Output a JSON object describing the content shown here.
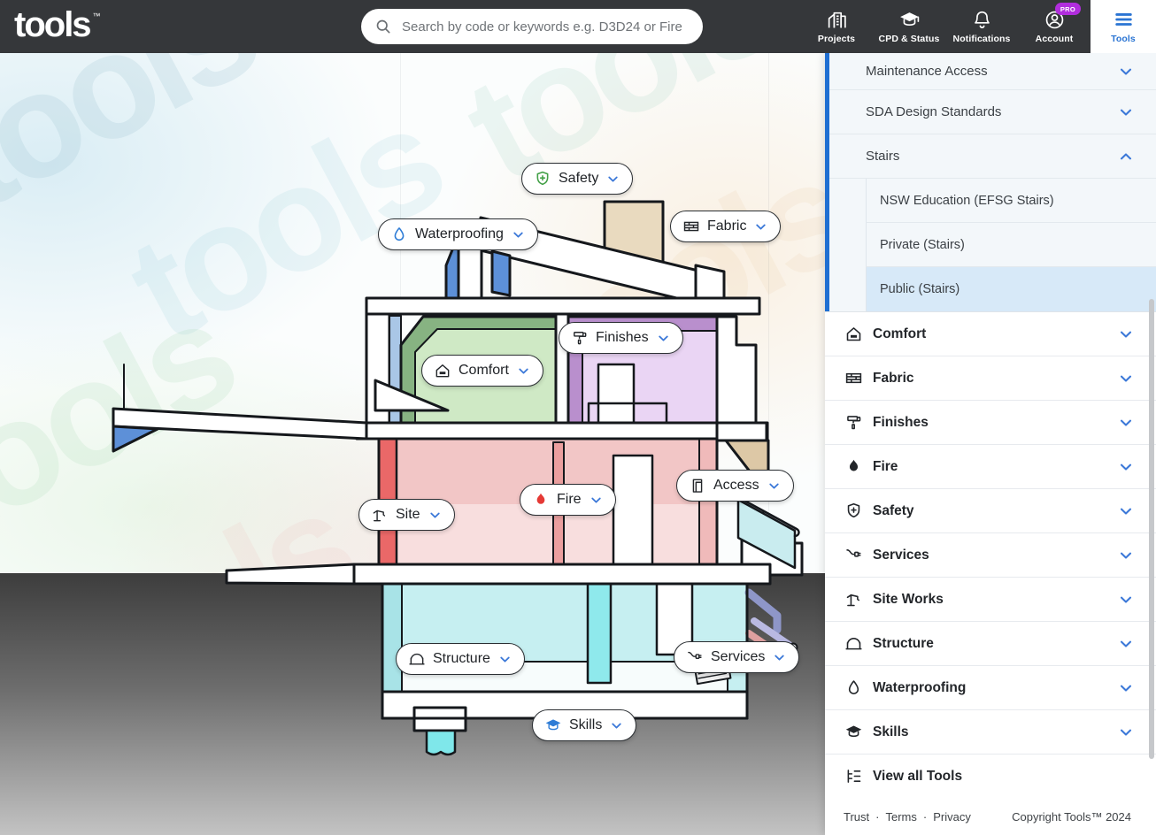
{
  "header": {
    "logo_text": "tools",
    "logo_tm": "™",
    "search": {
      "placeholder": "Search by code or keywords e.g. D3D24 or Fire"
    },
    "nav": [
      {
        "label": "Projects",
        "icon": "buildings-icon"
      },
      {
        "label": "CPD & Status",
        "icon": "graduation-cap-icon"
      },
      {
        "label": "Notifications",
        "icon": "bell-icon"
      },
      {
        "label": "Account",
        "icon": "person-circle-icon",
        "badge": "PRO"
      },
      {
        "label": "Tools",
        "icon": "hamburger-menu-icon",
        "active": true
      }
    ]
  },
  "canvas": {
    "watermark_text": "tools",
    "pills": [
      {
        "label": "Safety",
        "icon": "shield-plus-icon",
        "icon_color": "#43a047"
      },
      {
        "label": "Waterproofing",
        "icon": "droplet-icon",
        "icon_color": "#2e7cd6"
      },
      {
        "label": "Fabric",
        "icon": "bricks-icon",
        "icon_color": "#23262a"
      },
      {
        "label": "Finishes",
        "icon": "paint-roller-icon",
        "icon_color": "#23262a"
      },
      {
        "label": "Comfort",
        "icon": "house-bed-icon",
        "icon_color": "#23262a"
      },
      {
        "label": "Fire",
        "icon": "flame-icon",
        "icon_color": "#e53935"
      },
      {
        "label": "Access",
        "icon": "door-icon",
        "icon_color": "#23262a"
      },
      {
        "label": "Site",
        "icon": "crane-icon",
        "icon_color": "#23262a"
      },
      {
        "label": "Structure",
        "icon": "bridge-icon",
        "icon_color": "#23262a"
      },
      {
        "label": "Services",
        "icon": "plug-icon",
        "icon_color": "#23262a"
      },
      {
        "label": "Skills",
        "icon": "graduation-cap-icon",
        "icon_color": "#2e7cd6"
      }
    ]
  },
  "sidebar": {
    "expanded_group": {
      "items": [
        {
          "label": "Maintenance Access",
          "state": "collapsed"
        },
        {
          "label": "SDA Design Standards",
          "state": "collapsed"
        },
        {
          "label": "Stairs",
          "state": "expanded"
        }
      ],
      "sub_items": [
        {
          "label": "NSW Education (EFSG Stairs)",
          "selected": false
        },
        {
          "label": "Private (Stairs)",
          "selected": false
        },
        {
          "label": "Public (Stairs)",
          "selected": true
        }
      ]
    },
    "categories": [
      {
        "label": "Comfort",
        "icon": "house-bed-icon"
      },
      {
        "label": "Fabric",
        "icon": "bricks-icon"
      },
      {
        "label": "Finishes",
        "icon": "paint-roller-icon"
      },
      {
        "label": "Fire",
        "icon": "flame-icon"
      },
      {
        "label": "Safety",
        "icon": "shield-plus-icon"
      },
      {
        "label": "Services",
        "icon": "plug-icon"
      },
      {
        "label": "Site Works",
        "icon": "crane-icon"
      },
      {
        "label": "Structure",
        "icon": "bridge-icon"
      },
      {
        "label": "Waterproofing",
        "icon": "droplet-icon"
      },
      {
        "label": "Skills",
        "icon": "graduation-cap-icon"
      }
    ],
    "view_all_label": "View all Tools",
    "footer": {
      "links": [
        "Trust",
        "Terms",
        "Privacy"
      ],
      "separator": "·",
      "copyright": "Copyright Tools™ 2024"
    }
  },
  "colors": {
    "header_bg": "#35373a",
    "accent_blue": "#2a74d3",
    "chevron_blue": "#3b78d8",
    "active_group_bar": "#1f6fd2",
    "selected_item_bg": "#d7e9f8",
    "pro_badge": "#b12ddd",
    "safety_green": "#43a047",
    "fire_red": "#e53935",
    "water_blue": "#2e7cd6"
  }
}
